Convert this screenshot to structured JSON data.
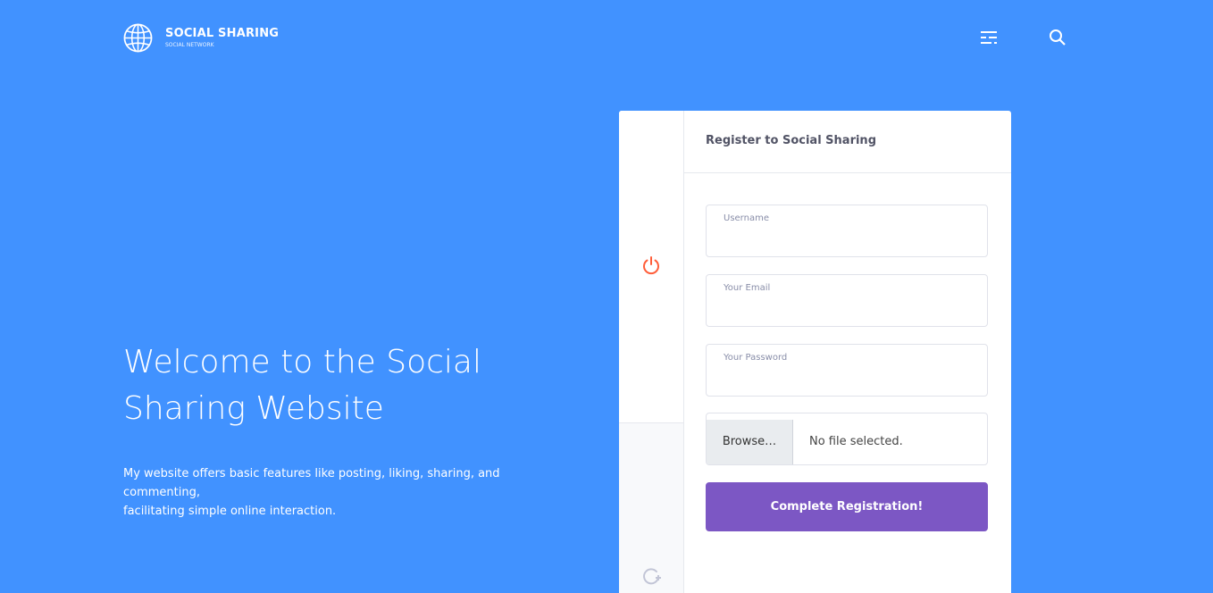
{
  "header": {
    "logo_title": "SOCIAL SHARING",
    "logo_subtitle": "SOCIAL NETWORK",
    "icons": [
      "globe-icon",
      "menu-icon",
      "search-icon"
    ]
  },
  "hero": {
    "title_line1": "Welcome to the Social",
    "title_line2": "Sharing Website",
    "description_line1": "My website offers basic features like posting, liking, sharing, and commenting,",
    "description_line2": "facilitating simple online interaction."
  },
  "register": {
    "title": "Register to Social Sharing",
    "username_label": "Username",
    "username_value": "",
    "email_label": "Your Email",
    "email_value": "",
    "password_label": "Your Password",
    "password_value": "",
    "browse_label": "Browse…",
    "file_status": "No file selected.",
    "submit_label": "Complete Registration!",
    "sidebar_icons": [
      "power-icon",
      "refresh-icon"
    ]
  },
  "colors": {
    "background": "#4192ff",
    "accent": "#7c57c4",
    "power_icon": "#ff5e3a"
  }
}
